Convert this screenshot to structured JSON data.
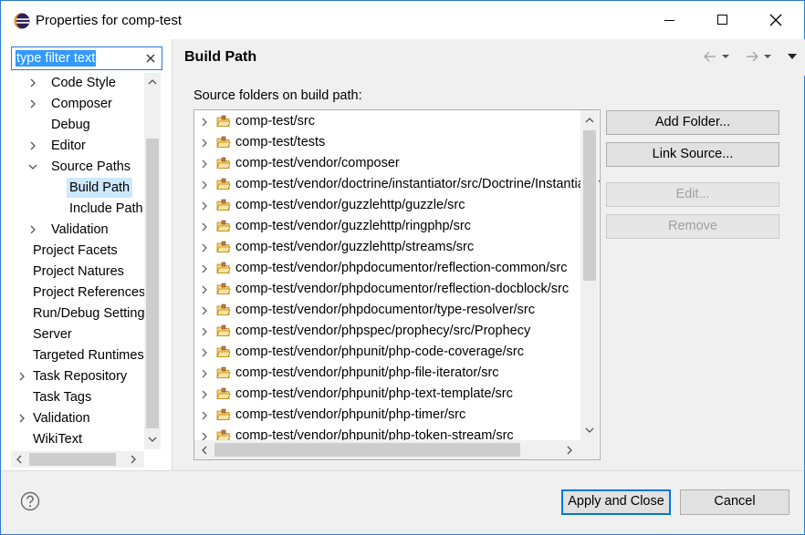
{
  "window": {
    "title": "Properties for comp-test"
  },
  "filter": {
    "value": "type filter text"
  },
  "tree": {
    "items": [
      {
        "label": "Code Style",
        "level": 2,
        "twisty": "collapsed"
      },
      {
        "label": "Composer",
        "level": 2,
        "twisty": "collapsed"
      },
      {
        "label": "Debug",
        "level": 2,
        "twisty": "none"
      },
      {
        "label": "Editor",
        "level": 2,
        "twisty": "collapsed"
      },
      {
        "label": "Source Paths",
        "level": 2,
        "twisty": "expanded"
      },
      {
        "label": "Build Path",
        "level": 3,
        "twisty": "none",
        "selected": true
      },
      {
        "label": "Include Path",
        "level": 3,
        "twisty": "none"
      },
      {
        "label": "Validation",
        "level": 2,
        "twisty": "collapsed"
      },
      {
        "label": "Project Facets",
        "level": 1,
        "twisty": "none"
      },
      {
        "label": "Project Natures",
        "level": 1,
        "twisty": "none"
      },
      {
        "label": "Project References",
        "level": 1,
        "twisty": "none"
      },
      {
        "label": "Run/Debug Settings",
        "level": 1,
        "twisty": "none"
      },
      {
        "label": "Server",
        "level": 1,
        "twisty": "none"
      },
      {
        "label": "Targeted Runtimes",
        "level": 1,
        "twisty": "none"
      },
      {
        "label": "Task Repository",
        "level": 1,
        "twisty": "collapsed"
      },
      {
        "label": "Task Tags",
        "level": 1,
        "twisty": "none"
      },
      {
        "label": "Validation",
        "level": 1,
        "twisty": "collapsed"
      },
      {
        "label": "WikiText",
        "level": 1,
        "twisty": "none"
      }
    ]
  },
  "page": {
    "title": "Build Path",
    "section_label": "Source folders on build path:",
    "folders": [
      "comp-test/src",
      "comp-test/tests",
      "comp-test/vendor/composer",
      "comp-test/vendor/doctrine/instantiator/src/Doctrine/Instantiator",
      "comp-test/vendor/guzzlehttp/guzzle/src",
      "comp-test/vendor/guzzlehttp/ringphp/src",
      "comp-test/vendor/guzzlehttp/streams/src",
      "comp-test/vendor/phpdocumentor/reflection-common/src",
      "comp-test/vendor/phpdocumentor/reflection-docblock/src",
      "comp-test/vendor/phpdocumentor/type-resolver/src",
      "comp-test/vendor/phpspec/prophecy/src/Prophecy",
      "comp-test/vendor/phpunit/php-code-coverage/src",
      "comp-test/vendor/phpunit/php-file-iterator/src",
      "comp-test/vendor/phpunit/php-text-template/src",
      "comp-test/vendor/phpunit/php-timer/src",
      "comp-test/vendor/phpunit/php-token-stream/src"
    ],
    "buttons": {
      "add_folder": "Add Folder...",
      "link_source": "Link Source...",
      "edit": "Edit...",
      "remove": "Remove"
    }
  },
  "footer": {
    "apply_close": "Apply and Close",
    "cancel": "Cancel"
  },
  "colors": {
    "accent": "#0078d7",
    "selection": "#cce8ff",
    "filter_highlight": "#3399ff",
    "folder": "#e8b33a"
  },
  "icons": [
    "eclipse-icon",
    "minimize-icon",
    "maximize-icon",
    "close-icon",
    "clear-icon",
    "back-icon",
    "forward-icon",
    "view-menu-icon",
    "folder-package-icon",
    "help-icon"
  ]
}
